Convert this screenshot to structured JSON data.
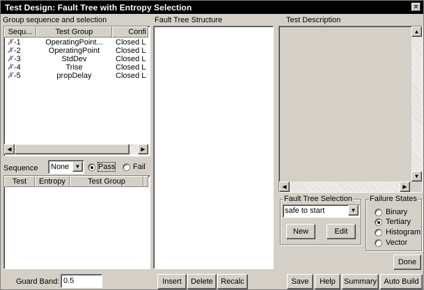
{
  "window": {
    "title": "Test Design: Fault Tree with Entropy Selection",
    "close_glyph": "✕"
  },
  "group_panel": {
    "label": "Group sequence and selection",
    "columns": [
      "Sequ...",
      "Test Group",
      "Confi"
    ],
    "rows": [
      {
        "seq": "-1",
        "group": "OperatingPoint...",
        "config": "Closed L"
      },
      {
        "seq": "-2",
        "group": "OperatingPoint",
        "config": "Closed L"
      },
      {
        "seq": "-3",
        "group": "StdDev",
        "config": "Closed L"
      },
      {
        "seq": "-4",
        "group": "Trise",
        "config": "Closed L"
      },
      {
        "seq": "-5",
        "group": "propDelay",
        "config": "Closed L"
      }
    ],
    "row_mark": "✗"
  },
  "sequence": {
    "label": "Sequence",
    "value": "None",
    "pass_label": "Pass",
    "fail_label": "Fail",
    "selected": "Pass"
  },
  "test_list": {
    "columns": [
      "Test",
      "Entropy",
      "Test Group"
    ]
  },
  "guard_band": {
    "label": "Guard Band:",
    "value": "0.5"
  },
  "fault_tree": {
    "label": "Fault Tree Structure"
  },
  "middle_buttons": {
    "insert": "Insert",
    "delete": "Delete",
    "recalc": "Recalc"
  },
  "test_description": {
    "label": "Test Description"
  },
  "fault_tree_selection": {
    "label": "Fault Tree Selection",
    "value": "safe to start",
    "new_label": "New",
    "edit_label": "Edit"
  },
  "failure_states": {
    "label": "Failure States",
    "options": [
      "Binary",
      "Tertiary",
      "Histogram",
      "Vector"
    ],
    "selected": "Tertiary"
  },
  "buttons": {
    "done": "Done",
    "save": "Save",
    "help": "Help",
    "summary": "Summary",
    "auto_build": "Auto Build"
  },
  "icons": {
    "arrow_left": "◀",
    "arrow_right": "▶",
    "arrow_up": "▲",
    "arrow_down": "▼"
  }
}
